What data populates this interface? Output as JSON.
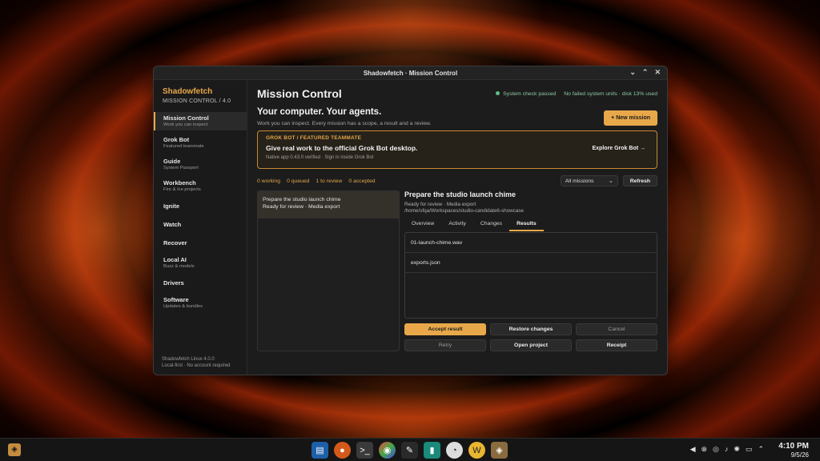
{
  "window": {
    "title": "Shadowfetch · Mission Control"
  },
  "sidebar": {
    "brand": "Shadowfetch",
    "subtitle": "MISSION CONTROL  /  4.0",
    "items": [
      {
        "label": "Mission Control",
        "sub": "Work you can inspect"
      },
      {
        "label": "Grok Bot",
        "sub": "Featured teammate"
      },
      {
        "label": "Guide",
        "sub": "System Passport"
      },
      {
        "label": "Workbench",
        "sub": "Fire & Ice projects"
      },
      {
        "label": "Ignite",
        "sub": ""
      },
      {
        "label": "Watch",
        "sub": ""
      },
      {
        "label": "Recover",
        "sub": ""
      },
      {
        "label": "Local AI",
        "sub": "Buzz & models"
      },
      {
        "label": "Drivers",
        "sub": ""
      },
      {
        "label": "Software",
        "sub": "Updates & bundles"
      }
    ],
    "footer_line1": "Shadowfetch Linux 4.0.0",
    "footer_line2": "Local-first · No account required"
  },
  "header": {
    "title": "Mission Control",
    "status_check": "System check passed",
    "status_units": "No failed system units · disk 13% used"
  },
  "hero": {
    "title": "Your computer. Your agents.",
    "subtitle": "Work you can inspect. Every mission has a scope, a result and a review.",
    "new_button": "+ New mission"
  },
  "feature": {
    "tag": "GROK BOT   /   FEATURED TEAMMATE",
    "title": "Give real work to the official Grok Bot desktop.",
    "meta": "Native app 0.43.0 verified · Sign in inside Grok Bot",
    "link": "Explore Grok Bot →"
  },
  "counts": {
    "working": "0 working",
    "queued": "0 queued",
    "review": "1 to review",
    "accepted": "0 accepted"
  },
  "filter": {
    "selected": "All missions",
    "refresh": "Refresh"
  },
  "missions": [
    {
      "name": "Prepare the studio launch chime",
      "state": "Ready for review  ·  Media export"
    }
  ],
  "detail": {
    "title": "Prepare the studio launch chime",
    "state": "Ready for review  ·  Media export",
    "path": "/home/sfqa/Workspaces/studio-candidate6-showcase",
    "tabs": [
      "Overview",
      "Activity",
      "Changes",
      "Results"
    ],
    "results": [
      "01-launch-chime.wav",
      "exports.json"
    ],
    "actions": {
      "accept": "Accept result",
      "restore": "Restore changes",
      "cancel": "Cancel",
      "retry": "Retry",
      "open": "Open project",
      "receipt": "Receipt"
    }
  },
  "taskbar": {
    "time": "4:10 PM",
    "date": "9/5/26"
  },
  "colors": {
    "accent": "#e8a84a",
    "ok": "#5fbf8a"
  }
}
